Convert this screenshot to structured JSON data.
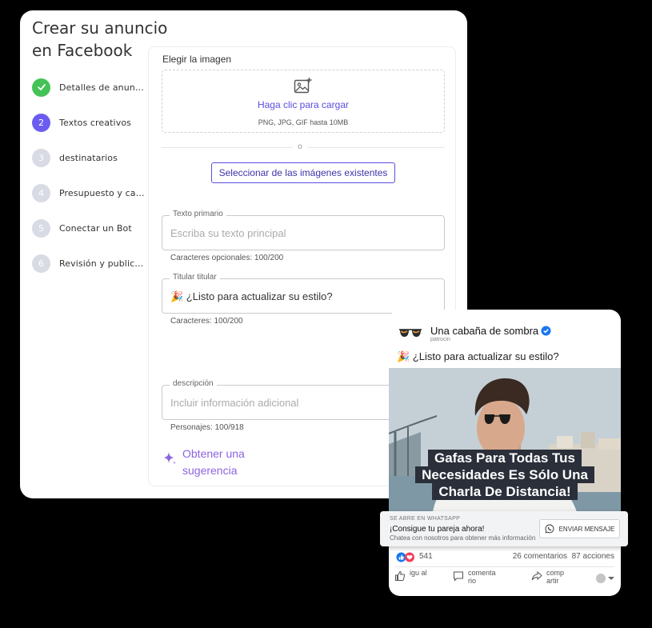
{
  "builder": {
    "title": "Crear su anuncio en Facebook",
    "steps": [
      {
        "num": "✓",
        "label": "Detalles de anuncios",
        "state": "done"
      },
      {
        "num": "2",
        "label": "Textos creativos",
        "state": "active"
      },
      {
        "num": "3",
        "label": "destinatarios",
        "state": "pending"
      },
      {
        "num": "4",
        "label": "Presupuesto y cale..",
        "state": "pending"
      },
      {
        "num": "5",
        "label": "Conectar un Bot",
        "state": "pending"
      },
      {
        "num": "6",
        "label": "Revisión y publicac..",
        "state": "pending"
      }
    ]
  },
  "form": {
    "image_label": "Elegir la imagen",
    "upload_cta": "Haga clic para cargar",
    "upload_hint": "PNG, JPG, GIF hasta 10MB",
    "divider_text": "o",
    "select_existing": "Seleccionar de las imágenes existentes",
    "primary_text": {
      "legend": "Texto primario",
      "placeholder": "Escriba su texto principal",
      "help": "Caracteres opcionales: 100/200"
    },
    "headline": {
      "legend": "Titular titular",
      "value": "🎉 ¿Listo para actualizar su estilo?",
      "help": "Caracteres: 100/200"
    },
    "description": {
      "legend": "descripción",
      "placeholder": "Incluir información adicional",
      "help": "Personajes: 100/918"
    },
    "suggestion": "Obtener una sugerencia"
  },
  "preview": {
    "page_name": "Una cabaña de sombra",
    "sponsored": "patrocin",
    "caption": "🎉 ¿Listo para actualizar su estilo?",
    "overlay_lines": [
      "Gafas Para Todas Tus",
      "Necesidades Es Sólo Una",
      "Charla De Distancia!"
    ],
    "likes": "541",
    "comments": "26 comentarios",
    "shares": "87 acciones",
    "actions": [
      "igu al",
      "comenta rio",
      "comp artir"
    ]
  },
  "whatsapp": {
    "top": "SE ABRE EN WHATSAPP",
    "title": "¡Consigue tu pareja ahora!",
    "sub": "Chatea con nosotros para obtener más información",
    "button": "ENVIAR MENSAJE"
  },
  "colors": {
    "accent": "#6b5cf0",
    "done": "#45c256",
    "link": "#5b4ee0",
    "suggest": "#8d63e0",
    "verified": "#1877f2"
  }
}
